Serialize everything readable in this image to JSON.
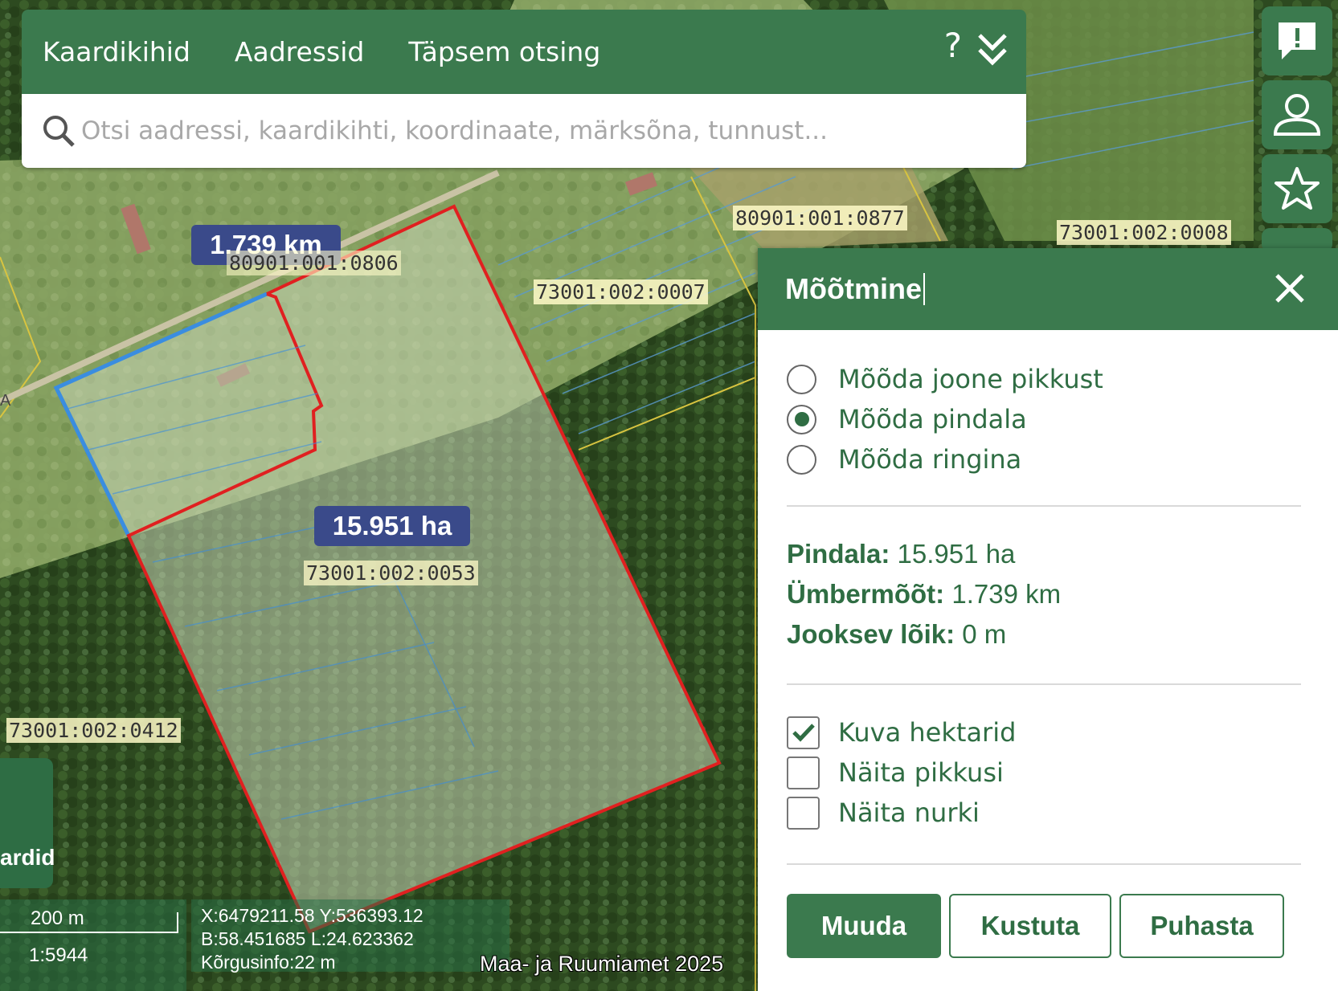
{
  "toolbar": {
    "tabs": [
      "Kaardikihid",
      "Aadressid",
      "Täpsem otsing"
    ],
    "help": "?"
  },
  "search": {
    "placeholder": "Otsi aadressi, kaardikihti, koordinaate, märksõna, tunnust..."
  },
  "side_buttons": [
    "feedback-icon",
    "user-icon",
    "star-icon"
  ],
  "map": {
    "perimeter_label": "1.739 km",
    "area_label": "15.951 ha",
    "parcels": [
      "80901:001:0877",
      "73001:002:0008",
      "80901:001:0806",
      "73001:002:0007",
      "73001:002:0053",
      "73001:002:0412"
    ],
    "road_label": "A",
    "kaardid_label": "ardid",
    "scale_text": "200 m",
    "scale_ratio": "1:5944",
    "coords": [
      "X:6479211.58 Y:536393.12",
      "B:58.451685 L:24.623362",
      "Kõrgusinfo:22 m"
    ],
    "copyright": "Maa- ja Ruumiamet 2025"
  },
  "panel": {
    "title": "Mõõtmine",
    "options": [
      "Mõõda joone pikkust",
      "Mõõda pindala",
      "Mõõda ringina"
    ],
    "selected_option": 1,
    "stats": {
      "area_label": "Pindala:",
      "area_value": "15.951 ha",
      "perimeter_label": "Ümbermõõt:",
      "perimeter_value": "1.739 km",
      "segment_label": "Jooksev lõik:",
      "segment_value": "0 m"
    },
    "checkboxes": [
      {
        "label": "Kuva hektarid",
        "checked": true
      },
      {
        "label": "Näita pikkusi",
        "checked": false
      },
      {
        "label": "Näita nurki",
        "checked": false
      }
    ],
    "buttons": [
      "Muuda",
      "Kustuta",
      "Puhasta"
    ]
  },
  "colors": {
    "accent": "#3b7a4e",
    "measure_line": "#e02020",
    "measure_segment": "#3a8de0",
    "label_bg": "#3a4a8a"
  }
}
